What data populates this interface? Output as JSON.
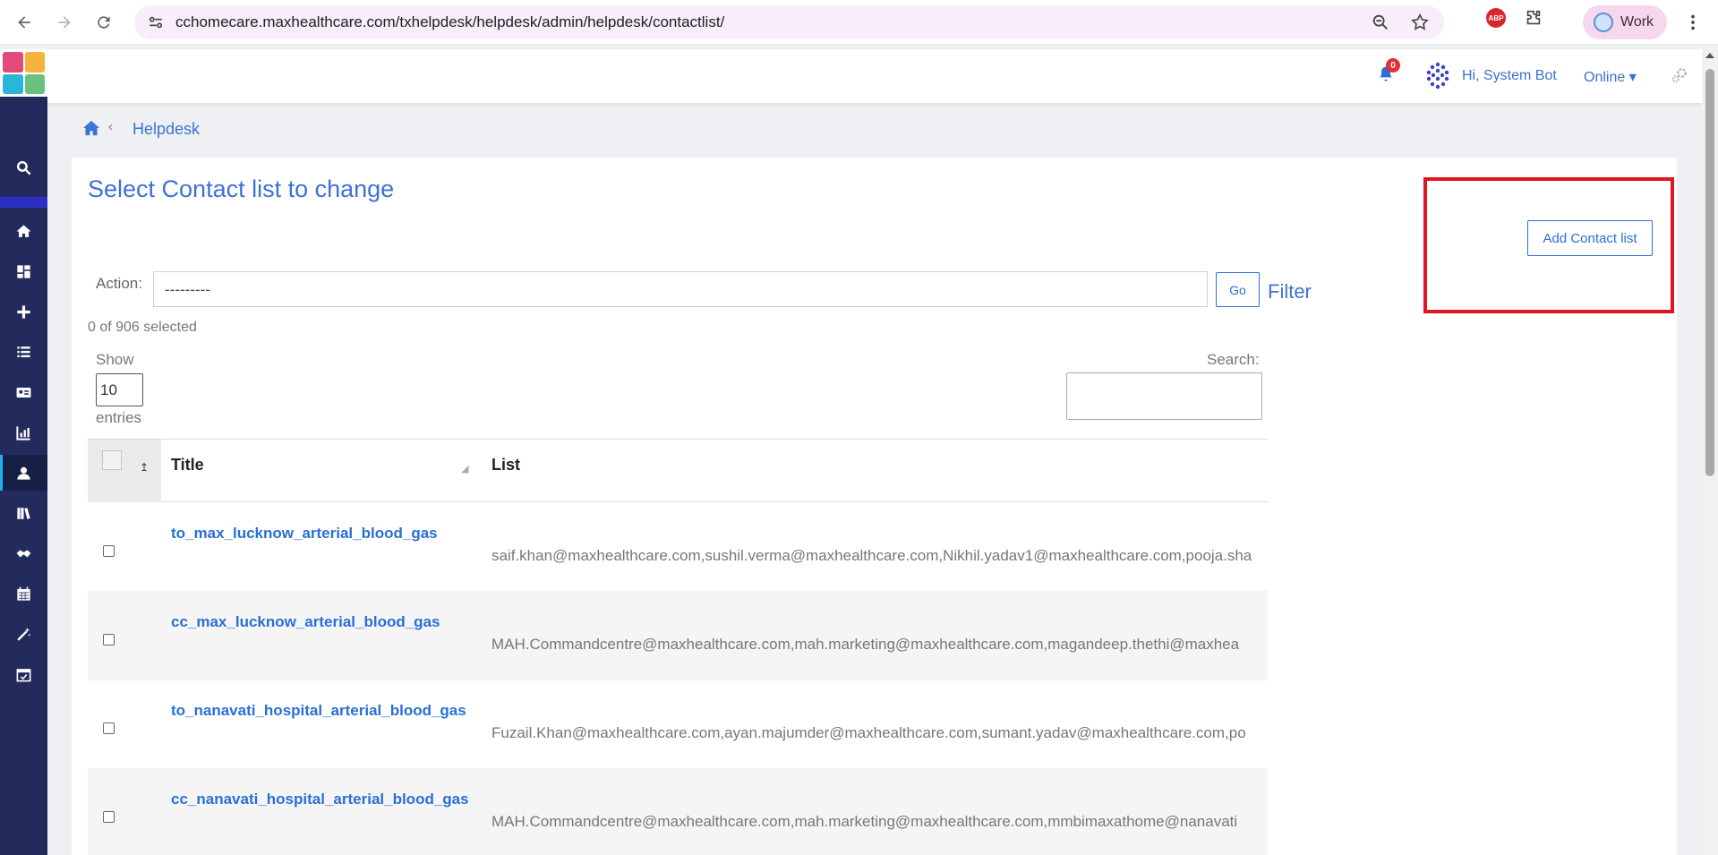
{
  "browser": {
    "url": "cchomecare.maxhealthcare.com/txhelpdesk/helpdesk/admin/helpdesk/contactlist/",
    "profile_label": "Work",
    "adblock_label": "ABP"
  },
  "header": {
    "notification_count": "0",
    "greeting": "Hi, System Bot",
    "status": "Online ▾"
  },
  "breadcrumb": {
    "separator": "‹",
    "current": "Helpdesk"
  },
  "page": {
    "title": "Select Contact list to change",
    "add_button": "Add Contact list",
    "action_label": "Action:",
    "action_value": "---------",
    "go_button": "Go",
    "filter_label": "Filter",
    "selected_count": "0 of 906 selected",
    "show_label": "Show",
    "show_value": "10",
    "entries_label": "entries",
    "search_label": "Search:"
  },
  "table": {
    "columns": [
      "Title",
      "List"
    ],
    "rows": [
      {
        "title": "to_max_lucknow_arterial_blood_gas",
        "list": "saif.khan@maxhealthcare.com,sushil.verma@maxhealthcare.com,Nikhil.yadav1@maxhealthcare.com,pooja.sha"
      },
      {
        "title": "cc_max_lucknow_arterial_blood_gas",
        "list": "MAH.Commandcentre@maxhealthcare.com,mah.marketing@maxhealthcare.com,magandeep.thethi@maxhea"
      },
      {
        "title": "to_nanavati_hospital_arterial_blood_gas",
        "list": "Fuzail.Khan@maxhealthcare.com,ayan.majumder@maxhealthcare.com,sumant.yadav@maxhealthcare.com,po"
      },
      {
        "title": "cc_nanavati_hospital_arterial_blood_gas",
        "list": "MAH.Commandcentre@maxhealthcare.com,mah.marketing@maxhealthcare.com,mmbimaxathome@nanavati"
      }
    ]
  },
  "colors": {
    "sidebar": "#232b5c",
    "accent": "#3f71d3",
    "highlight": "#e0161f"
  }
}
